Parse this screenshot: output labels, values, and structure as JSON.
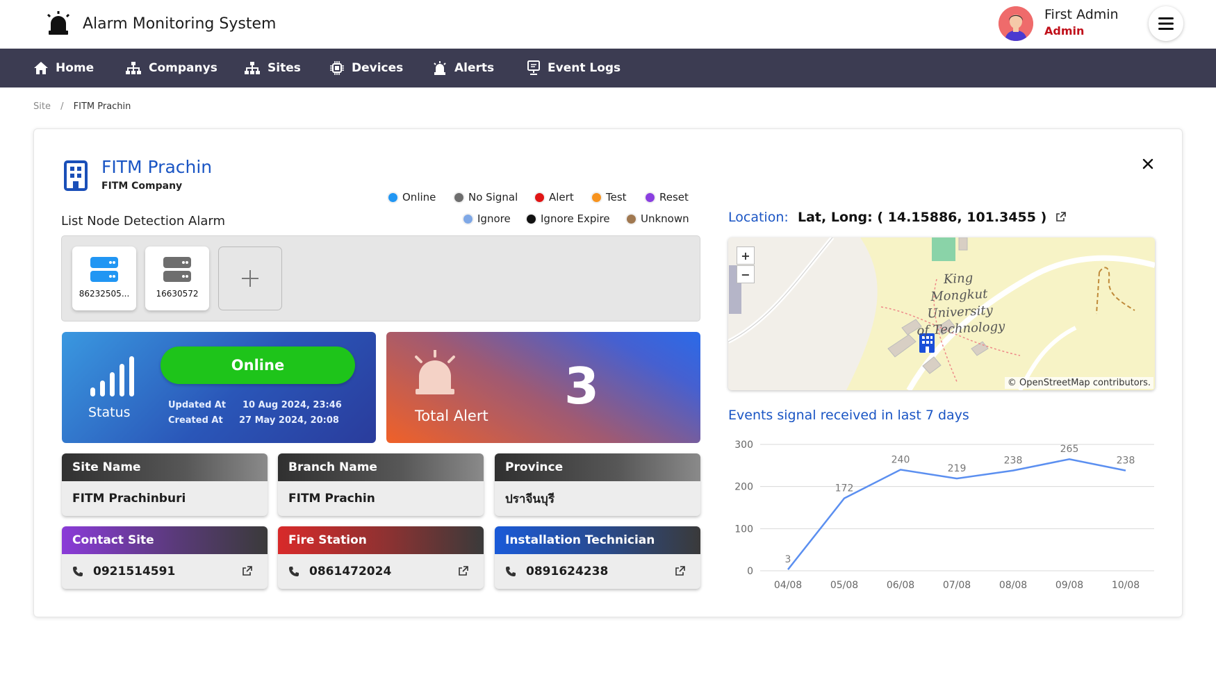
{
  "header": {
    "app_title": "Alarm Monitoring System",
    "user_name": "First Admin",
    "user_role": "Admin",
    "logo_icon": "siren-icon",
    "menu_icon": "hamburger-icon"
  },
  "nav": [
    {
      "label": "Home",
      "icon": "home-icon"
    },
    {
      "label": "Companys",
      "icon": "sitemap-icon"
    },
    {
      "label": "Sites",
      "icon": "sitemap-icon"
    },
    {
      "label": "Devices",
      "icon": "chip-icon"
    },
    {
      "label": "Alerts",
      "icon": "siren-icon"
    },
    {
      "label": "Event Logs",
      "icon": "monitor-icon"
    }
  ],
  "breadcrumb": {
    "parent": "Site",
    "separator": "/",
    "current": "FITM Prachin"
  },
  "site": {
    "title": "FITM Prachin",
    "company": "FITM Company"
  },
  "legend": [
    {
      "label": "Online",
      "color": "#2196f3"
    },
    {
      "label": "No Signal",
      "color": "#6e6e6e"
    },
    {
      "label": "Alert",
      "color": "#e01515"
    },
    {
      "label": "Test",
      "color": "#f7931e"
    },
    {
      "label": "Reset",
      "color": "#8a3fe0"
    },
    {
      "label": "Ignore",
      "color": "#7fa8e6"
    },
    {
      "label": "Ignore Expire",
      "color": "#111111"
    },
    {
      "label": "Unknown",
      "color": "#a07850"
    }
  ],
  "nodes": {
    "title": "List Node Detection Alarm",
    "items": [
      {
        "label": "86232505...",
        "color": "#2196f3"
      },
      {
        "label": "16630572",
        "color": "#6e6e6e"
      }
    ]
  },
  "status": {
    "button": "Online",
    "label": "Status",
    "updated_label": "Updated At",
    "updated_value": "10 Aug 2024, 23:46",
    "created_label": "Created At",
    "created_value": "27 May 2024, 20:08"
  },
  "alerts": {
    "label": "Total Alert",
    "count": "3"
  },
  "info": {
    "site_name": {
      "title": "Site Name",
      "value": "FITM Prachinburi"
    },
    "branch_name": {
      "title": "Branch Name",
      "value": "FITM Prachin"
    },
    "province": {
      "title": "Province",
      "value": "ปราจีนบุรี"
    },
    "contact_site": {
      "title": "Contact Site",
      "value": "0921514591"
    },
    "fire_station": {
      "title": "Fire Station",
      "value": "0861472024"
    },
    "technician": {
      "title": "Installation Technician",
      "value": "0891624238"
    }
  },
  "location": {
    "label": "Location:",
    "value": "Lat, Long: ( 14.15886, 101.3455 )"
  },
  "map": {
    "label_lines": [
      "King Mongkut",
      "University",
      "of Technology"
    ],
    "attribution": "© OpenStreetMap contributors.",
    "zoom_in": "+",
    "zoom_out": "−"
  },
  "chart_title": "Events signal received in last 7 days",
  "chart_data": {
    "type": "line",
    "categories": [
      "04/08",
      "05/08",
      "06/08",
      "07/08",
      "08/08",
      "09/08",
      "10/08"
    ],
    "values": [
      3,
      172,
      240,
      219,
      238,
      265,
      238
    ],
    "ylim": [
      0,
      300
    ],
    "yticks": [
      0,
      100,
      200,
      300
    ],
    "data_labels": true,
    "grid": true,
    "color": "#5b8ff0"
  }
}
